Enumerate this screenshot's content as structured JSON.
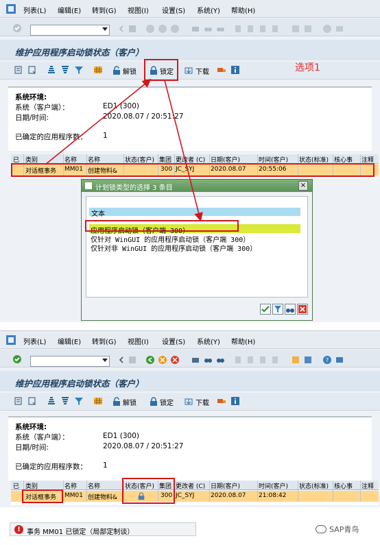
{
  "menu": [
    "列表(L)",
    "编辑(E)",
    "转到(G)",
    "视图(I)",
    "设置(S)",
    "系统(Y)",
    "帮助(H)"
  ],
  "screen": {
    "title": "维护应用程序启动锁状态（客户）",
    "toolbar": {
      "unlock": "解锁",
      "lock": "锁定",
      "download": "下载"
    },
    "info": {
      "heading": "系统环境:",
      "system_label": "系统（客户端）：",
      "system_value": "ED1 (300)",
      "datetime_label": "日期/时间:",
      "datetime_value": "2020.08.07 / 20:51:27",
      "count_label": "已确定的应用程序数：",
      "count_value": "1"
    },
    "table": {
      "headers": [
        "已",
        "类别",
        "名称",
        "名称",
        "状态(客户)",
        "集团",
        "更改者 (C)",
        "日期(客户)",
        "时间(客户)",
        "状态(标准)",
        "核心事",
        "注释"
      ],
      "row_top": {
        "category": "对话框事务",
        "code": "MM01",
        "name": "创建物料&",
        "client": "300",
        "changed_by": "JC_SYJ",
        "date": "2020.08.07",
        "time": "20:55:06"
      },
      "row_bottom": {
        "category": "对话框事务",
        "code": "MM01",
        "name": "创建物料&",
        "client": "300",
        "changed_by": "JC_SYJ",
        "date": "2020.08.07",
        "time": "21:08:42"
      }
    }
  },
  "dialog": {
    "title": "计划锁类型的选择 3 条目",
    "header": "文本",
    "options": [
      "应用程序启动锁（客户端 300）",
      "仅针对 WinGUI 的应用程序启动锁（客户端 300）",
      "仅针对非 WinGUI 的应用程序启动锁（客户端 300）"
    ]
  },
  "annotation": "选项1",
  "status_message": "事务 MM01 已锁定（局部定制谈）",
  "watermark": "SAP青鸟",
  "colors": {
    "highlight_row": "#ffd68a",
    "annotation_red": "#d2161d",
    "selected_option": "#d9ea3a",
    "dialog_title": "#5d9158"
  }
}
